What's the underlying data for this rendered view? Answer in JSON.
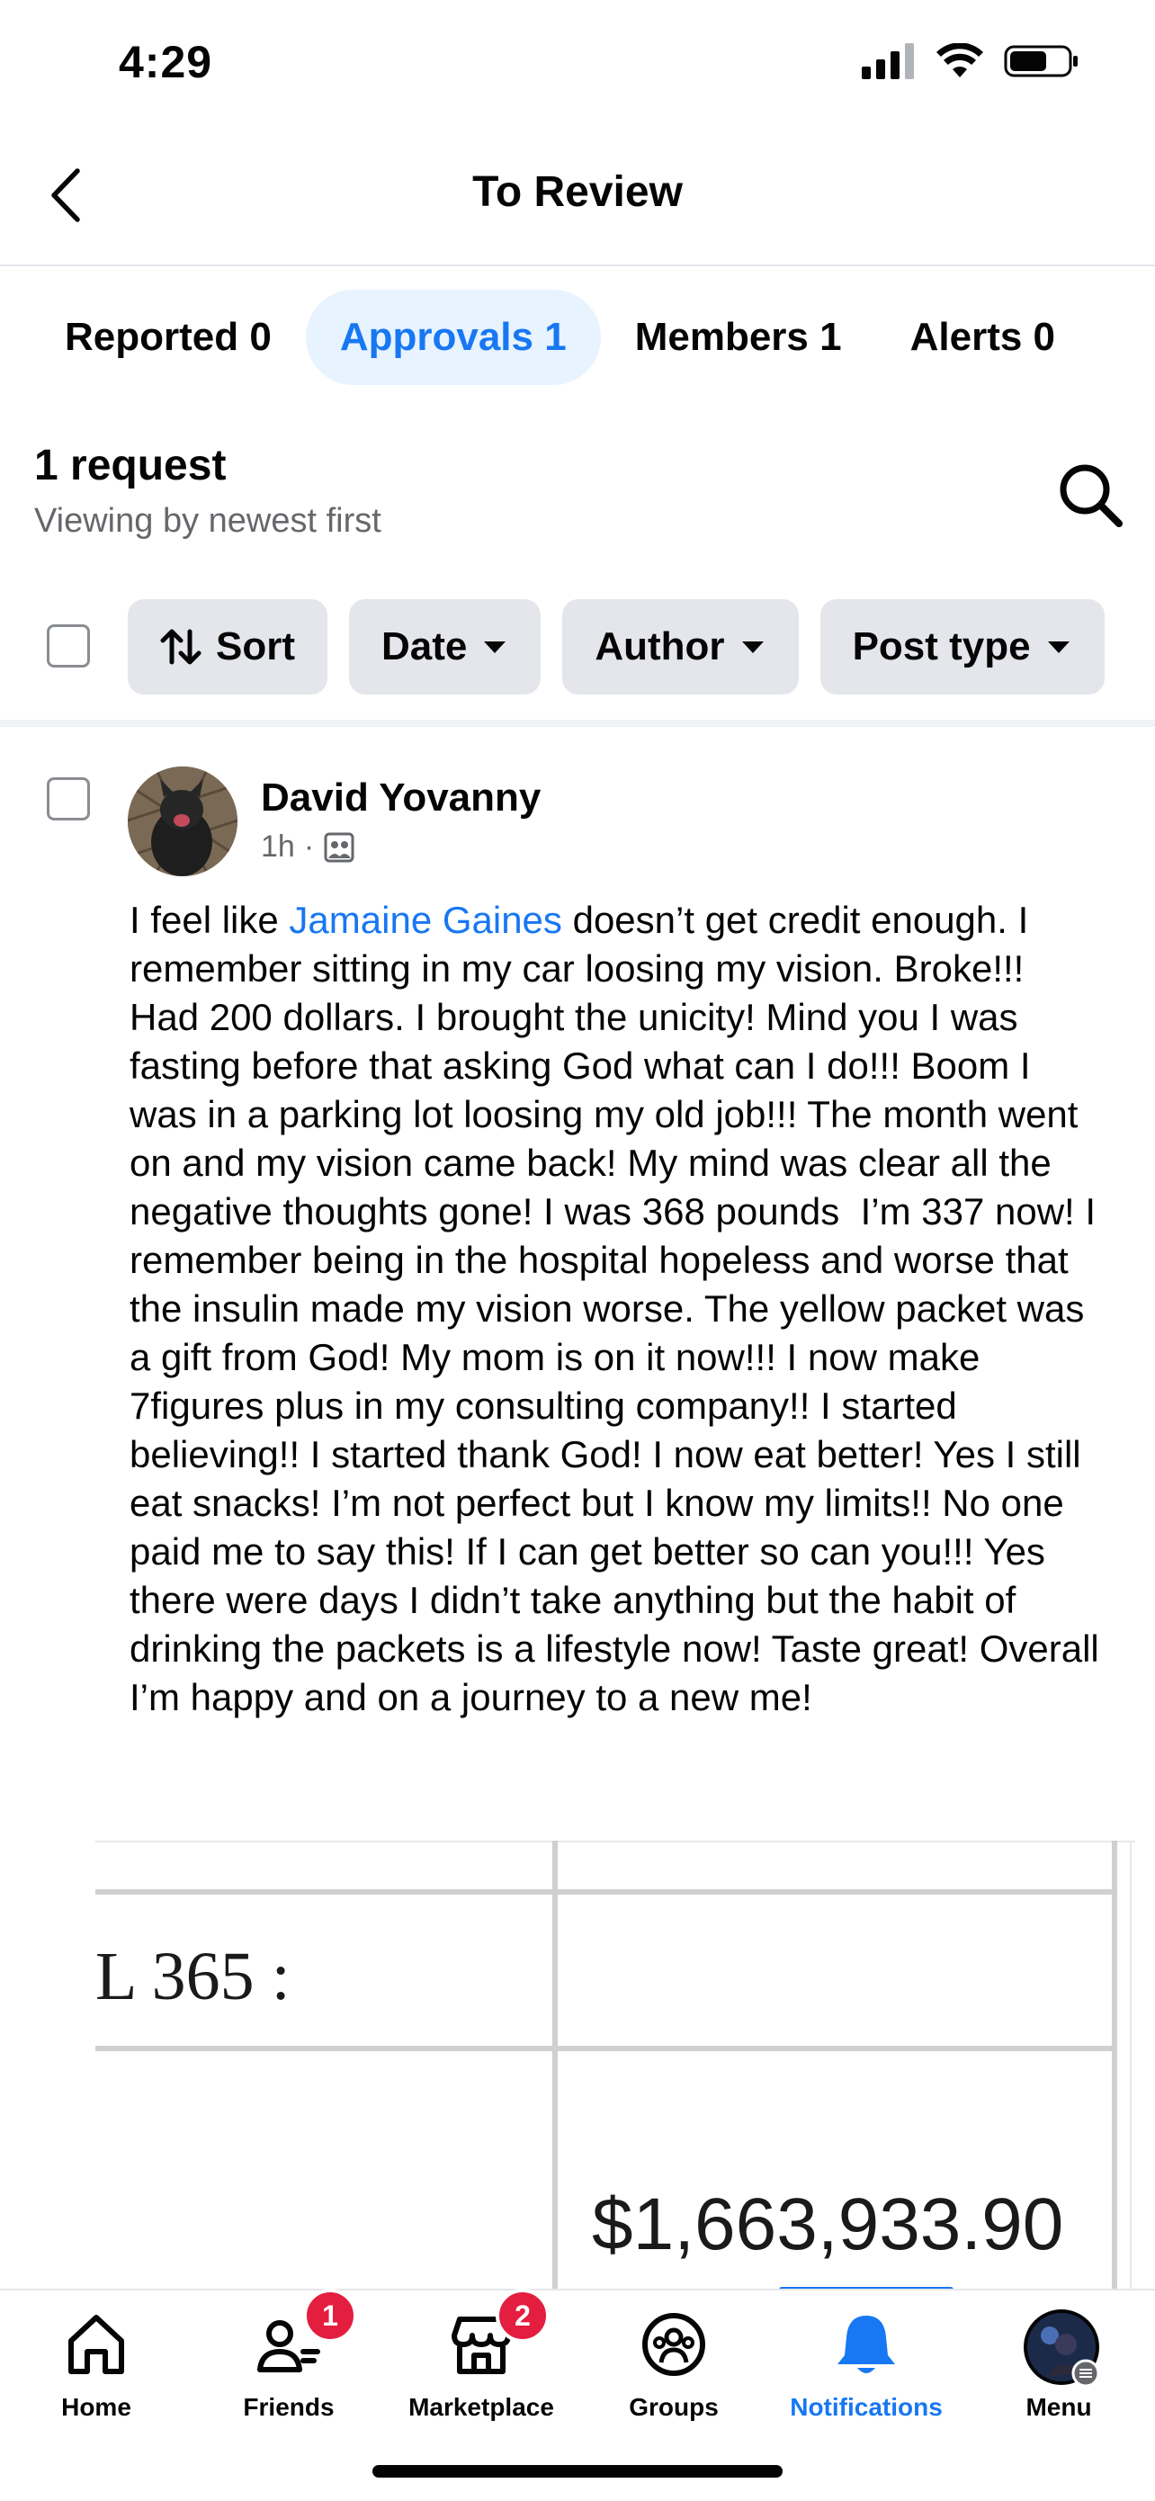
{
  "status_bar": {
    "time": "4:29"
  },
  "header": {
    "title": "To Review"
  },
  "tabs": [
    {
      "label": "Reported 0",
      "active": false
    },
    {
      "label": "Approvals 1",
      "active": true
    },
    {
      "label": "Members 1",
      "active": false
    },
    {
      "label": "Alerts 0",
      "active": false
    }
  ],
  "requests": {
    "title": "1 request",
    "subtitle": "Viewing by newest first"
  },
  "filters": {
    "sort": "Sort",
    "date": "Date",
    "author": "Author",
    "post_type": "Post type"
  },
  "post": {
    "author": "David Yovanny",
    "time": "1h",
    "text_before_mention": "I feel like ",
    "mention": "Jamaine Gaines",
    "text_after_mention": " doesn’t get credit enough. I remember sitting in my car loosing my vision. Broke!!! Had 200 dollars. I brought the unicity! Mind you I was fasting before that asking God what can I do!!! Boom I was in a parking lot loosing my old job!!! The month went on and my vision came back! My mind was clear all the negative thoughts gone! I was 368 pounds  I’m 337 now! I remember being in the hospital hopeless and worse that the insulin made my vision worse. The yellow packet was a gift from God! My mom is on it now!!! I now make 7figures plus in my consulting company!! I started believing!! I started thank God! I now eat better! Yes I still eat snacks! I’m not perfect but I know my limits!! No one paid me to say this! If I can get better so can you!!! Yes there were days I didn’t take anything but the habit of drinking the packets is a lifestyle now! Taste great! Overall I’m happy and on a journey to a new me!",
    "attachment": {
      "label": "L 365 :",
      "value": "$1,663,933.90"
    }
  },
  "bottom_nav": [
    {
      "label": "Home",
      "icon": "home-icon",
      "badge": ""
    },
    {
      "label": "Friends",
      "icon": "friends-icon",
      "badge": "1"
    },
    {
      "label": "Marketplace",
      "icon": "marketplace-icon",
      "badge": "2"
    },
    {
      "label": "Groups",
      "icon": "groups-icon",
      "badge": ""
    },
    {
      "label": "Notifications",
      "icon": "bell-icon",
      "badge": ""
    },
    {
      "label": "Menu",
      "icon": "profile-avatar",
      "badge": ""
    }
  ],
  "colors": {
    "accent": "#1877f2",
    "badge": "#e41e3f",
    "chip": "#e4e6eb",
    "secondary_text": "#65676b"
  }
}
